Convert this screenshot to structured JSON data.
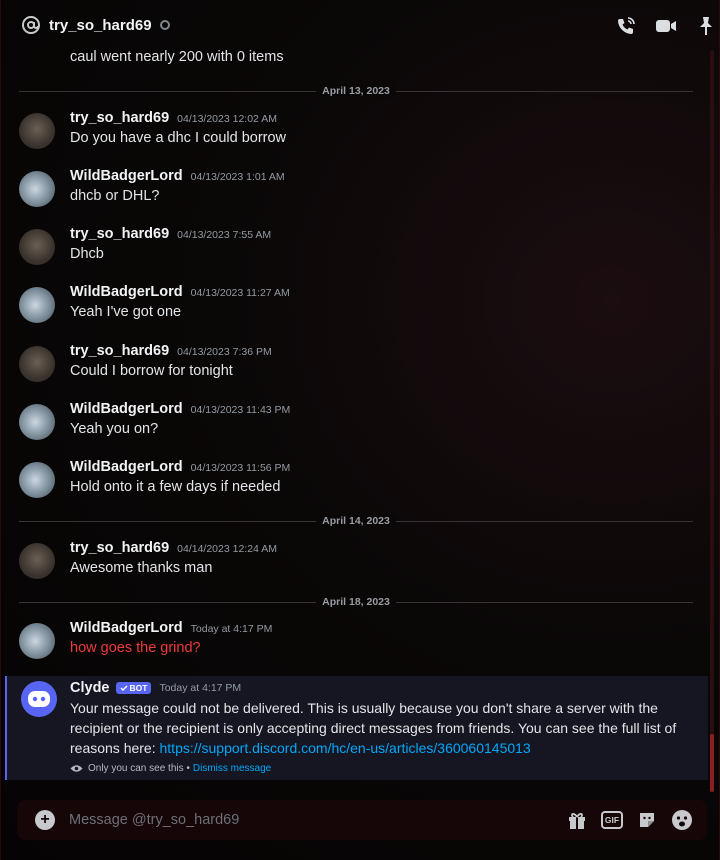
{
  "header": {
    "title": "try_so_hard69",
    "icons": [
      "at-icon",
      "status-icon",
      "voice-call-icon",
      "video-call-icon",
      "pin-icon"
    ]
  },
  "continuation_text": "caul went nearly 200 with  0 items",
  "dividers": [
    "April 13, 2023",
    "April 14, 2023",
    "April 18, 2023"
  ],
  "messages": [
    {
      "user": "try_so_hard69",
      "time": "04/13/2023 12:02 AM",
      "text": "Do you have a dhc I could borrow"
    },
    {
      "user": "WildBadgerLord",
      "time": "04/13/2023 1:01 AM",
      "text": "dhcb or DHL?"
    },
    {
      "user": "try_so_hard69",
      "time": "04/13/2023 7:55 AM",
      "text": "Dhcb"
    },
    {
      "user": "WildBadgerLord",
      "time": "04/13/2023 11:27 AM",
      "text": "Yeah I've got one"
    },
    {
      "user": "try_so_hard69",
      "time": "04/13/2023 7:36 PM",
      "text": "Could I borrow for tonight"
    },
    {
      "user": "WildBadgerLord",
      "time": "04/13/2023 11:43 PM",
      "text": "Yeah you on?"
    },
    {
      "user": "WildBadgerLord",
      "time": "04/13/2023 11:56 PM",
      "text": "Hold onto it a few days if needed"
    },
    {
      "user": "try_so_hard69",
      "time": "04/14/2023 12:24 AM",
      "text": "Awesome thanks man"
    },
    {
      "user": "WildBadgerLord",
      "time": "Today at 4:17 PM",
      "text": "how goes the grind?"
    }
  ],
  "clyde": {
    "name": "Clyde",
    "bot_tag": "BOT",
    "time": "Today at 4:17 PM",
    "text": "Your message could not be delivered. This is usually because you don't share a server with the recipient or the recipient is only accepting direct messages from friends. You can see the full list of reasons here: ",
    "link": "https://support.discord.com/hc/en-us/articles/360060145013",
    "ephemeral_note": "Only you can see this •",
    "dismiss_label": "Dismiss message"
  },
  "composer": {
    "placeholder": "Message @try_so_hard69",
    "icons": [
      "plus-icon",
      "gift-icon",
      "gif-icon",
      "sticker-icon",
      "emoji-icon"
    ]
  },
  "colors": {
    "accent": "#5865f2",
    "link": "#00a8fc",
    "error_text": "#ee3b3b",
    "scroll_thumb": "#8a1f23"
  }
}
